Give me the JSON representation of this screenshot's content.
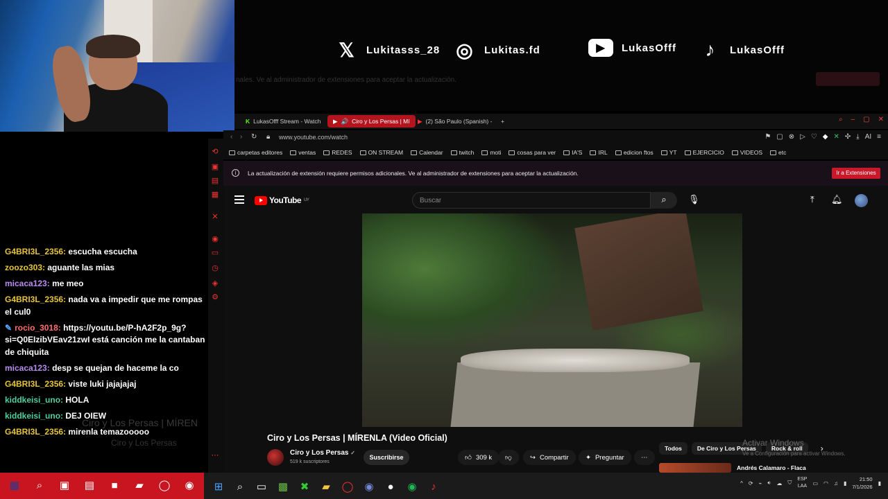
{
  "socials": [
    {
      "icon": "x-logo-icon",
      "glyph": "𝕏",
      "handle": "Lukitasss_28"
    },
    {
      "icon": "instagram-icon",
      "glyph": "◎",
      "handle": "Lukitas.fd"
    },
    {
      "icon": "youtube-icon",
      "glyph": "▶",
      "handle": "LukasOfff"
    },
    {
      "icon": "tiktok-icon",
      "glyph": "♪",
      "handle": "LukasOfff"
    }
  ],
  "banner_ghost_text": "nales. Ve al administrador de extensiones para aceptar la actualización.",
  "chat": {
    "messages": [
      {
        "user": "G4BRI3L_2356:",
        "text": "escucha escucha",
        "color": "#e6c53a"
      },
      {
        "user": "zoozo303:",
        "text": "aguante las mias",
        "color": "#e6c53a"
      },
      {
        "user": "micaca123:",
        "text": "me meo",
        "color": "#b98cf0"
      },
      {
        "user": "G4BRI3L_2356:",
        "text": "nada va a impedir que me rompas el cul0",
        "color": "#e6c53a"
      },
      {
        "user": "rocio_3018:",
        "text": "https://youtu.be/P-hA2F2p_9g?si=Q0EIzibVEav21zwI está canción me la cantaban de chiquita",
        "color": "#ff6f6f",
        "badge": "✎"
      },
      {
        "user": "micaca123:",
        "text": "desp se quejan de haceme la co",
        "color": "#b98cf0"
      },
      {
        "user": "G4BRI3L_2356:",
        "text": "viste luki jajajajaj",
        "color": "#e6c53a"
      },
      {
        "user": "kiddkeisi_uno:",
        "text": "HOLA",
        "color": "#4fd0a0"
      },
      {
        "user": "kiddkeisi_uno:",
        "text": "DEJ OIEW",
        "color": "#4fd0a0"
      },
      {
        "user": "G4BRI3L_2356:",
        "text": "mirenla temazooooo",
        "color": "#e6c53a"
      }
    ],
    "ghost_title": "Ciro y Los Persas | MÍREN",
    "ghost_sub": "Ciro y Los Persas"
  },
  "browser": {
    "tabs": [
      {
        "label": "LukasOfff Stream - Watch",
        "active": false
      },
      {
        "label": "Ciro y Los Persas | Mí",
        "active": true
      },
      {
        "label": "(2) São Paulo (Spanish) -",
        "active": false
      }
    ],
    "new_tab": "+",
    "url": "www.youtube.com/watch",
    "bookmarks": [
      "carpetas editores",
      "ventas",
      "REDES",
      "ON STREAM",
      "Calendar",
      "twitch",
      "moti",
      "cosas para ver",
      "IA'S",
      "IRL",
      "edicion ftos",
      "YT",
      "EJERCICIO",
      "VIDEOS",
      "etc"
    ],
    "notice": "La actualización de extensión requiere permisos adicionales. Ve al administrador de extensiones para aceptar la actualización.",
    "notice_button": "Ir a Extensiones"
  },
  "youtube": {
    "logo": "YouTube",
    "region": "UY",
    "search_placeholder": "Buscar",
    "video_title": "Ciro y Los Persas | MÍRENLA (Video Oficial)",
    "channel": "Ciro y Los Persas",
    "verified": "✓",
    "subscribers": "519 k suscriptores",
    "subscribe": "Suscribirse",
    "likes": "309 k",
    "share": "Compartir",
    "ask": "Preguntar",
    "more": "⋯",
    "chips": [
      "Todos",
      "De Ciro y Los Persas",
      "Rock & roll"
    ],
    "rec_title": "Andrés Calamaro - Flaca",
    "activate_title": "Activar Windows",
    "activate_sub": "Ve a Configuración para activar Windows."
  },
  "taskbar": {
    "lang_top": "ESP",
    "lang_bottom": "LAA",
    "time": "21:50",
    "date": "7/1/2026"
  }
}
